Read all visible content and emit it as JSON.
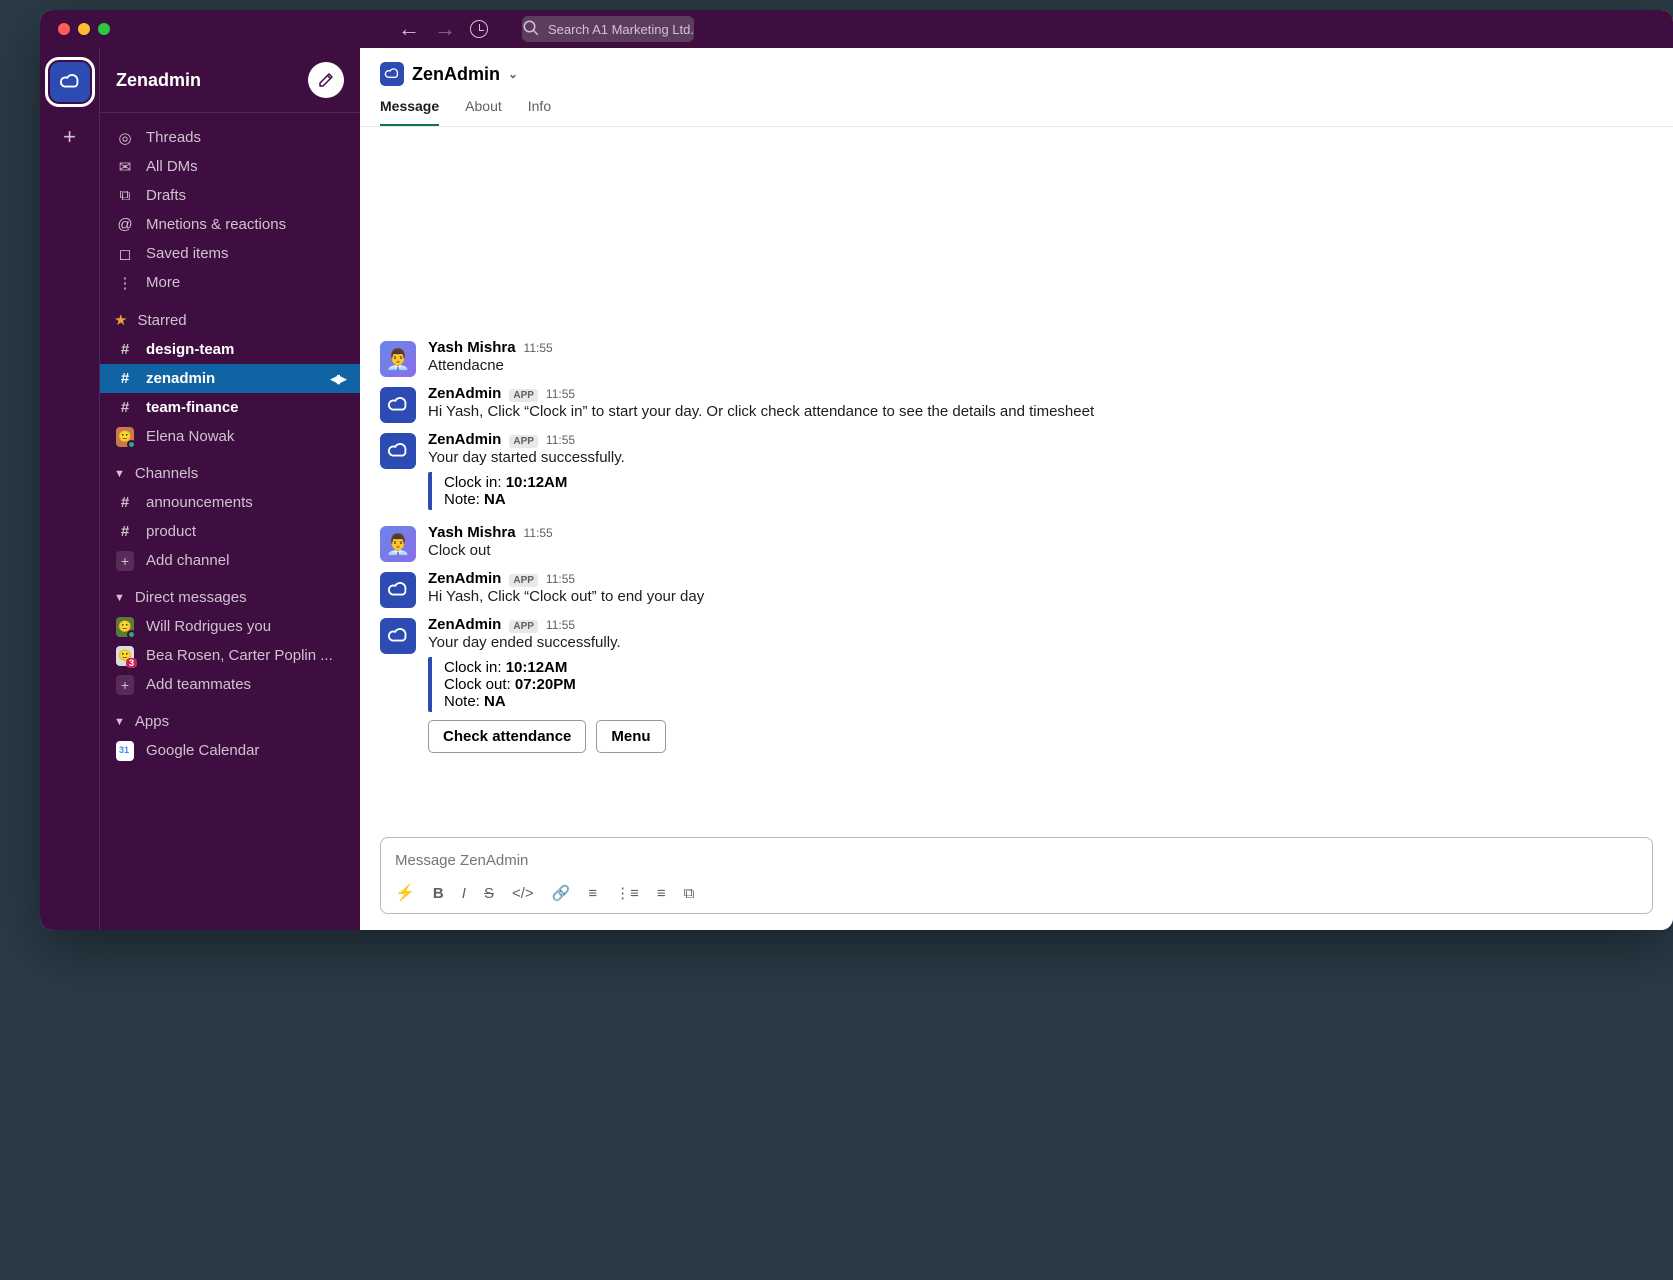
{
  "search": {
    "placeholder": "Search A1 Marketing Ltd."
  },
  "workspace": {
    "name": "Zenadmin"
  },
  "sidebar": {
    "nav": {
      "threads": "Threads",
      "dms": "All DMs",
      "drafts": "Drafts",
      "mentions": "Mnetions & reactions",
      "saved": "Saved items",
      "more": "More"
    },
    "sections": {
      "starred": "Starred",
      "channels": "Channels",
      "dms": "Direct messages",
      "apps": "Apps"
    },
    "starred": [
      {
        "name": "design-team",
        "type": "channel"
      },
      {
        "name": "zenadmin",
        "type": "channel",
        "selected": true
      },
      {
        "name": "team-finance",
        "type": "channel"
      },
      {
        "name": "Elena Nowak",
        "type": "user"
      }
    ],
    "channels": [
      {
        "name": "announcements"
      },
      {
        "name": "product"
      }
    ],
    "addChannel": "Add channel",
    "dms": [
      {
        "name": "Will Rodrigues you"
      },
      {
        "name": "Bea Rosen, Carter Poplin ...",
        "badge": "3"
      }
    ],
    "addTeammates": "Add teammates",
    "apps": [
      {
        "name": "Google Calendar"
      }
    ]
  },
  "channel": {
    "name": "ZenAdmin",
    "tabs": {
      "message": "Message",
      "about": "About",
      "info": "Info"
    }
  },
  "messages": [
    {
      "kind": "user",
      "name": "Yash Mishra",
      "time": "11:55",
      "text": "Attendacne"
    },
    {
      "kind": "bot",
      "name": "ZenAdmin",
      "time": "11:55",
      "text": "Hi Yash, Click “Clock in” to start your day. Or click check attendance to see the details and timesheet"
    },
    {
      "kind": "bot",
      "name": "ZenAdmin",
      "time": "11:55",
      "text": "Your day started successfully.",
      "block": [
        {
          "label": "Clock in:",
          "value": "10:12AM"
        },
        {
          "label": "Note:",
          "value": "NA"
        }
      ]
    },
    {
      "kind": "user",
      "name": "Yash Mishra",
      "time": "11:55",
      "text": "Clock out"
    },
    {
      "kind": "bot",
      "name": "ZenAdmin",
      "time": "11:55",
      "text": "Hi Yash, Click “Clock out” to end your day"
    },
    {
      "kind": "bot",
      "name": "ZenAdmin",
      "time": "11:55",
      "text": "Your day ended successfully.",
      "block": [
        {
          "label": "Clock in:",
          "value": "10:12AM"
        },
        {
          "label": "Clock out:",
          "value": "07:20PM"
        },
        {
          "label": "Note:",
          "value": "NA"
        }
      ],
      "buttons": [
        "Check attendance",
        "Menu"
      ]
    }
  ],
  "appBadge": "APP",
  "composer": {
    "placeholder": "Message ZenAdmin"
  }
}
